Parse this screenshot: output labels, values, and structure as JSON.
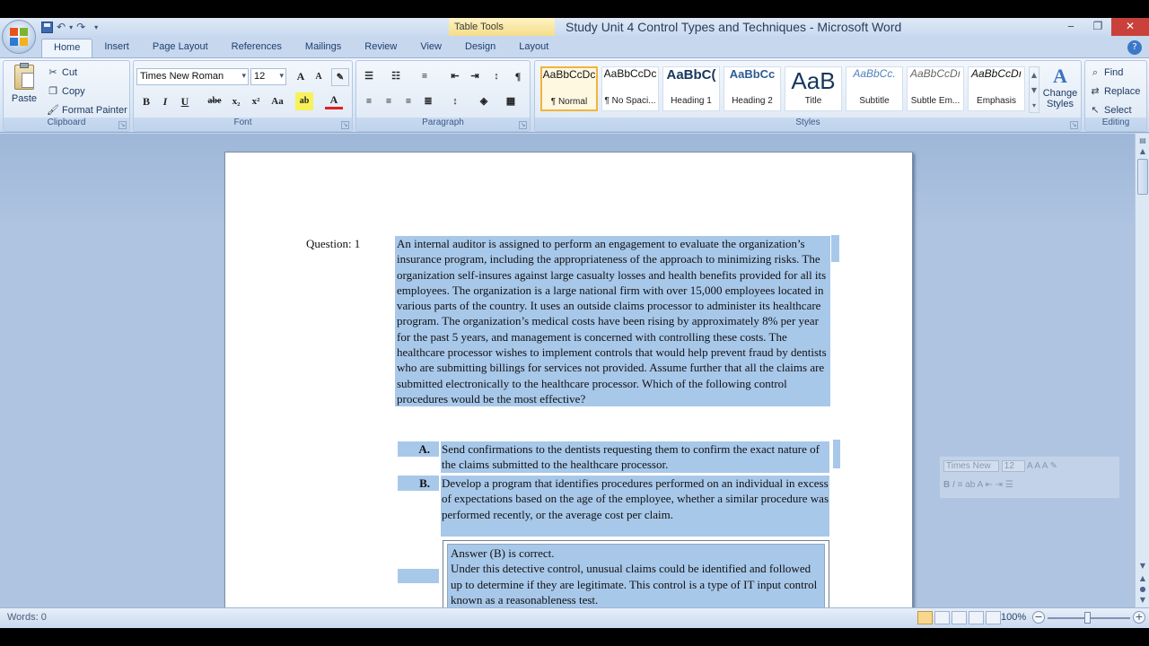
{
  "window": {
    "title": "Study Unit 4  Control Types and Techniques - Microsoft Word",
    "context_tab_group": "Table Tools",
    "controls": {
      "minimize": "‒",
      "restore": "❐",
      "close": "✕"
    }
  },
  "quick_access": {
    "undo": "↶",
    "redo": "↷",
    "more": "▾"
  },
  "tabs": [
    "Home",
    "Insert",
    "Page Layout",
    "References",
    "Mailings",
    "Review",
    "View",
    "Design",
    "Layout"
  ],
  "ribbon": {
    "clipboard": {
      "label": "Clipboard",
      "paste": "Paste",
      "cut": "Cut",
      "copy": "Copy",
      "format_painter": "Format Painter"
    },
    "font": {
      "label": "Font",
      "font_name": "Times New Roman",
      "font_size": "12",
      "bold": "B",
      "italic": "I",
      "underline": "U",
      "strike": "abe",
      "subscript": "x₂",
      "superscript": "x²",
      "change_case": "Aa",
      "grow": "A",
      "shrink": "A",
      "font_color_letter": "A"
    },
    "paragraph": {
      "label": "Paragraph"
    },
    "styles": {
      "label": "Styles",
      "items": [
        {
          "sample": "AaBbCcDc",
          "name": "¶ Normal"
        },
        {
          "sample": "AaBbCcDc",
          "name": "¶ No Spaci..."
        },
        {
          "sample": "AaBbC(",
          "name": "Heading 1"
        },
        {
          "sample": "AaBbCc",
          "name": "Heading 2"
        },
        {
          "sample": "AaB",
          "name": "Title"
        },
        {
          "sample": "AaBbCc.",
          "name": "Subtitle"
        },
        {
          "sample": "AaBbCcDı",
          "name": "Subtle Em..."
        },
        {
          "sample": "AaBbCcDı",
          "name": "Emphasis"
        }
      ],
      "change_styles_1": "Change",
      "change_styles_2": "Styles"
    },
    "editing": {
      "label": "Editing",
      "find": "Find",
      "replace": "Replace",
      "select": "Select"
    }
  },
  "document": {
    "question_label": "Question: 1",
    "question_text": "An internal auditor is assigned to perform an engagement to evaluate the organization’s insurance program, including the appropriateness of the approach to minimizing risks. The organization self-insures against large casualty losses and health benefits provided for all its employees. The organization is a large national firm with over 15,000 employees located in various parts of the country. It uses an outside claims processor to administer its healthcare program. The organization’s medical costs have been rising by approximately 8% per year for the past 5 years, and management is concerned with controlling these costs. The healthcare processor wishes to implement controls that would help prevent fraud by dentists who are submitting billings for services not provided. Assume further that all the claims are submitted electronically to the healthcare processor. Which of the following control procedures would be the most effective?",
    "options": [
      {
        "letter": "A.",
        "text": "Send confirmations to the dentists requesting them to confirm the exact nature of the claims submitted to the healthcare processor."
      },
      {
        "letter": "B.",
        "text": "Develop a program that identifies procedures performed on an individual in excess of expectations based on the age of the employee, whether a similar procedure was performed recently, or the average cost per claim."
      }
    ],
    "answer_heading": "Answer (B) is correct.",
    "answer_text": "Under this detective control, unusual claims could be identified and followed up to determine if they are legitimate. This control is a type of IT input control known as a reasonableness test."
  },
  "mini_toolbar": {
    "font": "Times New",
    "size": "12"
  },
  "status": {
    "words": "Words: 0",
    "zoom": "100%"
  }
}
